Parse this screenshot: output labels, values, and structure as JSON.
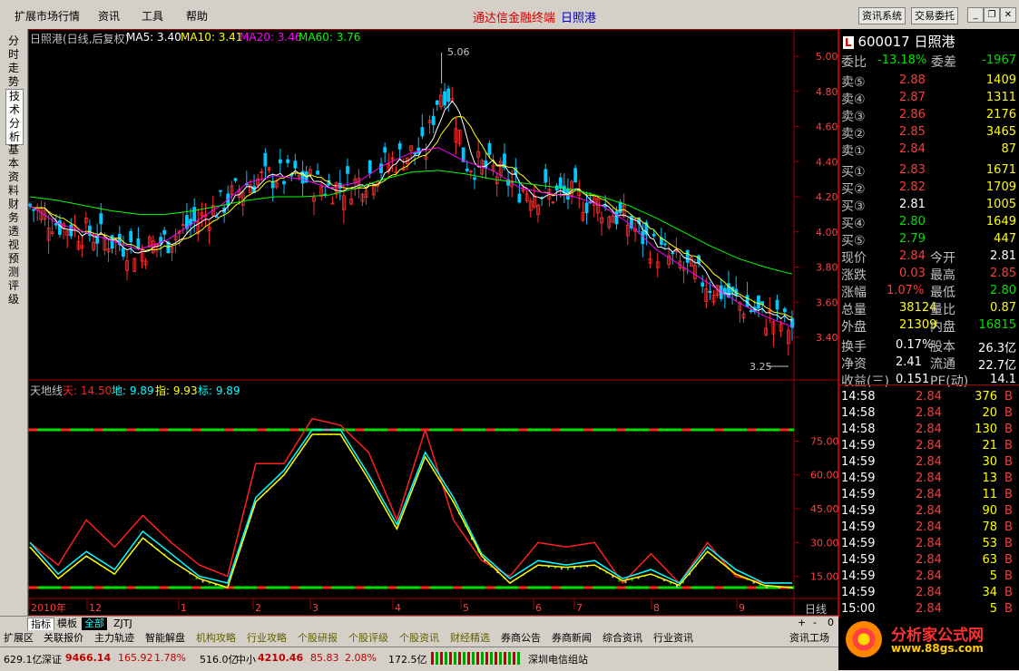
{
  "menu": [
    "扩展市场行情",
    "资讯",
    "工具",
    "帮助"
  ],
  "window_title": {
    "app": "通达信金融终端",
    "stock": "日照港"
  },
  "top_buttons": [
    "资讯系统",
    "交易委托"
  ],
  "left_tabs": [
    "分时走势",
    "技术分析",
    "基本资料",
    "财务透视",
    "预测评级"
  ],
  "main_chart": {
    "title": "日照港(日线,后复权)",
    "ma": [
      {
        "label": "MA5: 3.40",
        "color": "#ffffff"
      },
      {
        "label": "MA10: 3.41",
        "color": "#ffff00"
      },
      {
        "label": "MA20: 3.46",
        "color": "#ff00ff"
      },
      {
        "label": "MA60: 3.76",
        "color": "#00ff00"
      }
    ],
    "price_ticks": [
      "5.00",
      "4.80",
      "4.60",
      "4.40",
      "4.20",
      "4.00",
      "3.80",
      "3.60",
      "3.40"
    ],
    "high_label": "5.06",
    "low_label": "3.25"
  },
  "chart_data": [
    {
      "type": "line",
      "title": "日照港(日线,后复权)",
      "ylim": [
        3.2,
        5.1
      ],
      "series": [
        {
          "name": "MA20",
          "values": [
            4.15,
            4.05,
            4.0,
            3.95,
            3.9,
            3.95,
            4.05,
            4.15,
            4.28,
            4.32,
            4.3,
            4.25,
            4.28,
            4.38,
            4.45,
            4.48,
            4.4,
            4.35,
            4.25,
            4.22,
            4.2,
            4.15,
            4.05,
            3.9,
            3.8,
            3.7,
            3.6,
            3.52,
            3.46
          ]
        },
        {
          "name": "MA60",
          "values": [
            4.2,
            4.18,
            4.15,
            4.12,
            4.1,
            4.1,
            4.12,
            4.15,
            4.18,
            4.2,
            4.2,
            4.21,
            4.25,
            4.3,
            4.34,
            4.35,
            4.33,
            4.3,
            4.28,
            4.26,
            4.24,
            4.2,
            4.15,
            4.08,
            4.0,
            3.92,
            3.85,
            3.8,
            3.76
          ]
        }
      ],
      "high": 5.06,
      "low": 3.25
    },
    {
      "type": "line",
      "title": "天地线",
      "ylim": [
        10,
        90
      ],
      "series": [
        {
          "name": "天",
          "values": [
            30,
            20,
            40,
            28,
            42,
            30,
            20,
            15,
            65,
            65,
            85,
            82,
            70,
            40,
            80,
            40,
            22,
            15,
            30,
            28,
            30,
            12,
            25,
            12,
            30,
            15,
            12,
            12
          ]
        },
        {
          "name": "地",
          "values": [
            30,
            16,
            26,
            18,
            35,
            25,
            15,
            12,
            50,
            62,
            80,
            80,
            60,
            38,
            70,
            50,
            25,
            14,
            22,
            20,
            22,
            14,
            18,
            12,
            28,
            18,
            12,
            12
          ]
        },
        {
          "name": "指",
          "values": [
            28,
            14,
            24,
            16,
            32,
            22,
            14,
            10,
            48,
            60,
            78,
            78,
            58,
            36,
            68,
            48,
            24,
            12,
            20,
            19,
            20,
            13,
            16,
            11,
            26,
            16,
            11,
            10
          ]
        }
      ],
      "hlines": [
        80,
        10
      ]
    }
  ],
  "indicator": {
    "name": "天地线",
    "tian": "天: 14.50",
    "di": "地: 9.89",
    "zhi": "指: 9.93",
    "biao": "标: 9.89",
    "ticks": [
      "75.00",
      "60.00",
      "45.00",
      "30.00",
      "15.00"
    ]
  },
  "x_axis": [
    "2010年",
    "12",
    "1",
    "2",
    "3",
    "4",
    "5",
    "6",
    "7",
    "8",
    "9"
  ],
  "period_label": "日线",
  "quote": {
    "code": "600017",
    "name": "日照港",
    "weibi_label": "委比",
    "weibi": "-13.18%",
    "weicha_label": "委差",
    "weicha": "-1967",
    "sells": [
      {
        "label": "卖⑤",
        "price": "2.88",
        "vol": "1409"
      },
      {
        "label": "卖④",
        "price": "2.87",
        "vol": "1311"
      },
      {
        "label": "卖③",
        "price": "2.86",
        "vol": "2176"
      },
      {
        "label": "卖②",
        "price": "2.85",
        "vol": "3465"
      },
      {
        "label": "卖①",
        "price": "2.84",
        "vol": "87"
      }
    ],
    "buys": [
      {
        "label": "买①",
        "price": "2.83",
        "vol": "1671"
      },
      {
        "label": "买②",
        "price": "2.82",
        "vol": "1709"
      },
      {
        "label": "买③",
        "price": "2.81",
        "vol": "1005"
      },
      {
        "label": "买④",
        "price": "2.80",
        "vol": "1649"
      },
      {
        "label": "买⑤",
        "price": "2.79",
        "vol": "447"
      }
    ],
    "stats": [
      {
        "l1": "现价",
        "v1": "2.84",
        "l2": "今开",
        "v2": "2.81"
      },
      {
        "l1": "涨跌",
        "v1": "0.03",
        "l2": "最高",
        "v2": "2.85"
      },
      {
        "l1": "涨幅",
        "v1": "1.07%",
        "l2": "最低",
        "v2": "2.80"
      },
      {
        "l1": "总量",
        "v1": "38124",
        "l2": "量比",
        "v2": "0.87"
      },
      {
        "l1": "外盘",
        "v1": "21309",
        "l2": "内盘",
        "v2": "16815"
      }
    ],
    "stats2": [
      {
        "l1": "换手",
        "v1": "0.17%",
        "l2": "股本",
        "v2": "26.3亿"
      },
      {
        "l1": "净资",
        "v1": "2.41",
        "l2": "流通",
        "v2": "22.7亿"
      },
      {
        "l1": "收益(三)",
        "v1": "0.151",
        "l2": "PE(动)",
        "v2": "14.1"
      }
    ]
  },
  "ticks": [
    {
      "time": "14:58",
      "price": "2.84",
      "vol": "376",
      "bs": "B"
    },
    {
      "time": "14:58",
      "price": "2.84",
      "vol": "20",
      "bs": "B"
    },
    {
      "time": "14:58",
      "price": "2.84",
      "vol": "130",
      "bs": "B"
    },
    {
      "time": "14:59",
      "price": "2.84",
      "vol": "21",
      "bs": "B"
    },
    {
      "time": "14:59",
      "price": "2.84",
      "vol": "30",
      "bs": "B"
    },
    {
      "time": "14:59",
      "price": "2.84",
      "vol": "13",
      "bs": "B"
    },
    {
      "time": "14:59",
      "price": "2.84",
      "vol": "11",
      "bs": "B"
    },
    {
      "time": "14:59",
      "price": "2.84",
      "vol": "90",
      "bs": "B"
    },
    {
      "time": "14:59",
      "price": "2.84",
      "vol": "78",
      "bs": "B"
    },
    {
      "time": "14:59",
      "price": "2.84",
      "vol": "53",
      "bs": "B"
    },
    {
      "time": "14:59",
      "price": "2.84",
      "vol": "63",
      "bs": "B"
    },
    {
      "time": "14:59",
      "price": "2.84",
      "vol": "5",
      "bs": "B"
    },
    {
      "time": "14:59",
      "price": "2.84",
      "vol": "34",
      "bs": "B"
    },
    {
      "time": "15:00",
      "price": "2.84",
      "vol": "5",
      "bs": "B"
    }
  ],
  "tabs1": [
    "指标",
    "模板",
    "全部",
    "ZJTJ"
  ],
  "tabs2": [
    "扩展区",
    "关联报价",
    "主力轨迹",
    "智能解盘",
    "机构攻略",
    "行业攻略",
    "个股研报",
    "个股评级",
    "个股资讯",
    "财经精选",
    "券商公告",
    "券商新闻",
    "综合资讯",
    "行业资讯",
    "资讯工场"
  ],
  "status": {
    "s1": "629.1亿",
    "sz_name": "深证",
    "sz_val": "9466.14",
    "sz_chg": "165.92",
    "sz_pct": "1.78%",
    "s2": "516.0亿",
    "zx_name": "中小",
    "zx_val": "4210.46",
    "zx_chg": "85.83",
    "zx_pct": "2.08%",
    "s3": "172.5亿",
    "site": "深圳电信组站"
  },
  "logo": {
    "brand": "分析家公式网",
    "url": "www.88gs.com"
  },
  "zoom_ctrl": [
    "+",
    "-",
    "0"
  ]
}
